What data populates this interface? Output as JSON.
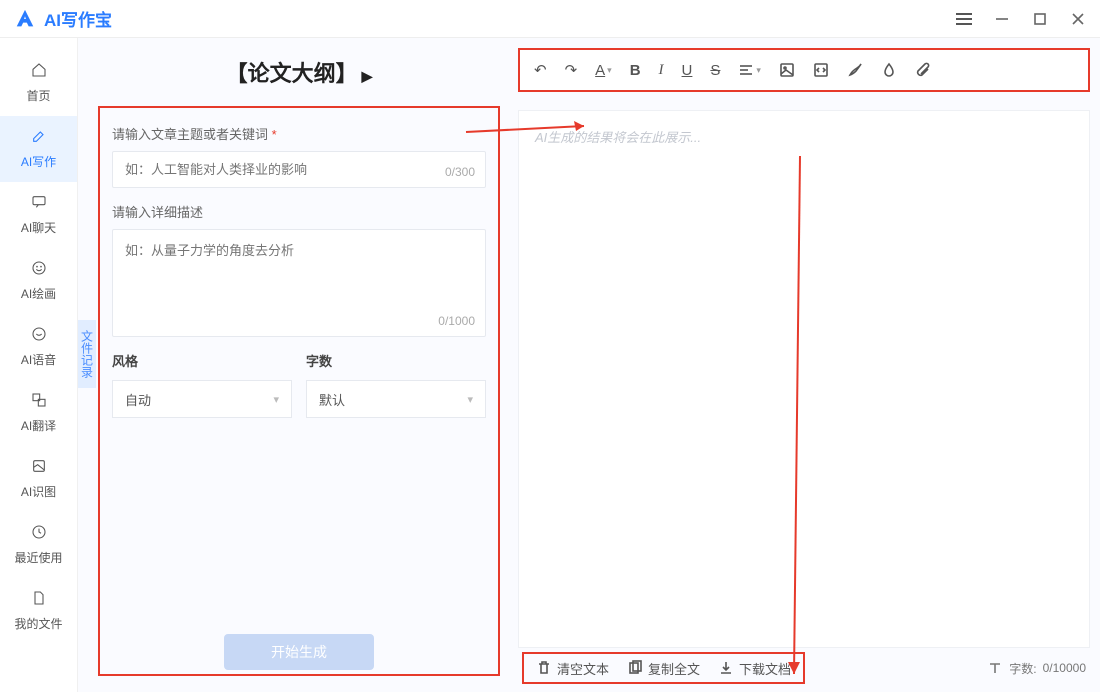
{
  "app": {
    "name": "AI写作宝"
  },
  "sidebar": {
    "items": [
      {
        "label": "首页"
      },
      {
        "label": "AI写作"
      },
      {
        "label": "AI聊天"
      },
      {
        "label": "AI绘画"
      },
      {
        "label": "AI语音"
      },
      {
        "label": "AI翻译"
      },
      {
        "label": "AI识图"
      },
      {
        "label": "最近使用"
      },
      {
        "label": "我的文件"
      }
    ]
  },
  "vtab": {
    "label": "文件记录"
  },
  "left": {
    "title": "【论文大纲】",
    "label_topic": "请输入文章主题或者关键词",
    "placeholder_topic": "如：人工智能对人类择业的影响",
    "counter_topic": "0/300",
    "label_desc": "请输入详细描述",
    "placeholder_desc": "如：从量子力学的角度去分析",
    "counter_desc": "0/1000",
    "style_label": "风格",
    "style_value": "自动",
    "count_label": "字数",
    "count_value": "默认",
    "generate": "开始生成"
  },
  "editor": {
    "placeholder": "AI生成的结果将会在此展示..."
  },
  "footer": {
    "clear": "清空文本",
    "copy": "复制全文",
    "download": "下载文档",
    "wordcount_label": "字数:",
    "wordcount_value": "0/10000"
  }
}
